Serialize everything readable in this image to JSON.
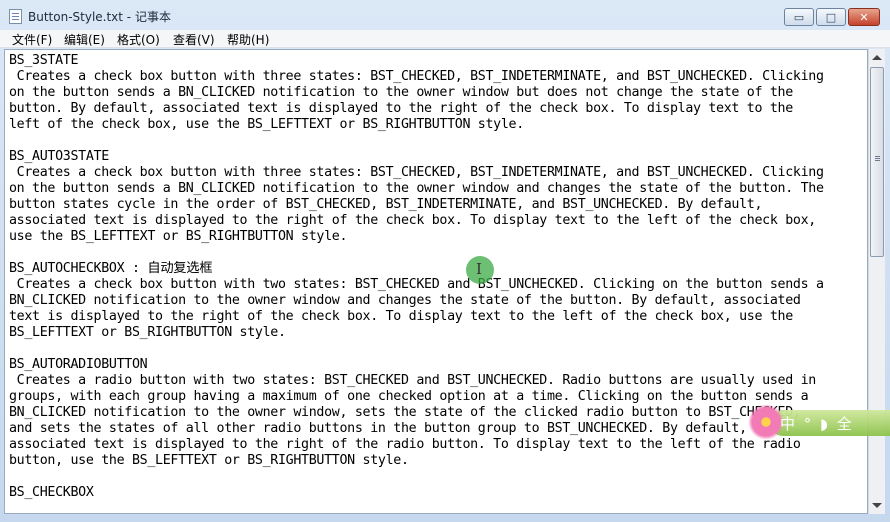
{
  "window": {
    "title": "Button-Style.txt - 记事本",
    "minimize_symbol": "▭",
    "maximize_symbol": "□",
    "close_symbol": "✕"
  },
  "menubar": {
    "file": "文件(F)",
    "edit": "编辑(E)",
    "format": "格式(O)",
    "view": "查看(V)",
    "help": "帮助(H)"
  },
  "document": {
    "text": "BS_3STATE\n Creates a check box button with three states: BST_CHECKED, BST_INDETERMINATE, and BST_UNCHECKED. Clicking\non the button sends a BN_CLICKED notification to the owner window but does not change the state of the\nbutton. By default, associated text is displayed to the right of the check box. To display text to the\nleft of the check box, use the BS_LEFTTEXT or BS_RIGHTBUTTON style.\n\nBS_AUTO3STATE\n Creates a check box button with three states: BST_CHECKED, BST_INDETERMINATE, and BST_UNCHECKED. Clicking\non the button sends a BN_CLICKED notification to the owner window and changes the state of the button. The\nbutton states cycle in the order of BST_CHECKED, BST_INDETERMINATE, and BST_UNCHECKED. By default,\nassociated text is displayed to the right of the check box. To display text to the left of the check box,\nuse the BS_LEFTTEXT or BS_RIGHTBUTTON style.\n\nBS_AUTOCHECKBOX : 自动复选框\n Creates a check box button with two states: BST_CHECKED and BST_UNCHECKED. Clicking on the button sends a\nBN_CLICKED notification to the owner window and changes the state of the button. By default, associated\ntext is displayed to the right of the check box. To display text to the left of the check box, use the\nBS_LEFTTEXT or BS_RIGHTBUTTON style.\n\nBS_AUTORADIOBUTTON\n Creates a radio button with two states: BST_CHECKED and BST_UNCHECKED. Radio buttons are usually used in\ngroups, with each group having a maximum of one checked option at a time. Clicking on the button sends a\nBN_CLICKED notification to the owner window, sets the state of the clicked radio button to BST_CHECKED,\nand sets the states of all other radio buttons in the button group to BST_UNCHECKED. By default,\nassociated text is displayed to the right of the radio button. To display text to the left of the radio\nbutton, use the BS_LEFTTEXT or BS_RIGHTBUTTON style.\n\nBS_CHECKBOX"
  },
  "ime_toolbar": {
    "text": "中 ° ◗ 全"
  },
  "colors": {
    "close_button": "#c4432c",
    "cursor_highlight": "#3caa46",
    "ime_bar": "#8cc24a"
  },
  "icons": {
    "app": "notepad-icon",
    "cursor": "text-cursor-icon",
    "ime": "ime-flower-icon"
  }
}
